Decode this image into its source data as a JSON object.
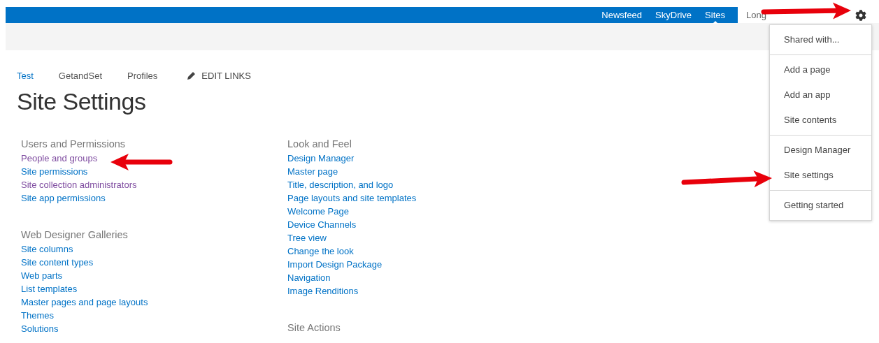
{
  "suite_bar": {
    "links": [
      {
        "label": "Newsfeed",
        "selected": false
      },
      {
        "label": "SkyDrive",
        "selected": false
      },
      {
        "label": "Sites",
        "selected": true
      }
    ],
    "user_name": "Long"
  },
  "settings_menu": {
    "groups": [
      [
        "Shared with..."
      ],
      [
        "Add a page",
        "Add an app",
        "Site contents"
      ],
      [
        "Design Manager",
        "Site settings"
      ],
      [
        "Getting started"
      ]
    ]
  },
  "nav": [
    {
      "label": "Test",
      "selected": true
    },
    {
      "label": "GetandSet",
      "selected": false
    },
    {
      "label": "Profiles",
      "selected": false
    }
  ],
  "edit_links": "EDIT LINKS",
  "title": "Site Settings",
  "columns": [
    [
      {
        "heading": "Users and Permissions",
        "links": [
          {
            "label": "People and groups",
            "visited": true
          },
          {
            "label": "Site permissions",
            "visited": false
          },
          {
            "label": "Site collection administrators",
            "visited": true
          },
          {
            "label": "Site app permissions",
            "visited": false
          }
        ]
      },
      {
        "heading": "Web Designer Galleries",
        "links": [
          {
            "label": "Site columns",
            "visited": false
          },
          {
            "label": "Site content types",
            "visited": false
          },
          {
            "label": "Web parts",
            "visited": false
          },
          {
            "label": "List templates",
            "visited": false
          },
          {
            "label": "Master pages and page layouts",
            "visited": false
          },
          {
            "label": "Themes",
            "visited": false
          },
          {
            "label": "Solutions",
            "visited": false
          }
        ]
      }
    ],
    [
      {
        "heading": "Look and Feel",
        "links": [
          {
            "label": "Design Manager",
            "visited": false
          },
          {
            "label": "Master page",
            "visited": false
          },
          {
            "label": "Title, description, and logo",
            "visited": false
          },
          {
            "label": "Page layouts and site templates",
            "visited": false
          },
          {
            "label": "Welcome Page",
            "visited": false
          },
          {
            "label": "Device Channels",
            "visited": false
          },
          {
            "label": "Tree view",
            "visited": false
          },
          {
            "label": "Change the look",
            "visited": false
          },
          {
            "label": "Import Design Package",
            "visited": false
          },
          {
            "label": "Navigation",
            "visited": false
          },
          {
            "label": "Image Renditions",
            "visited": false
          }
        ]
      },
      {
        "heading": "Site Actions"
      }
    ]
  ]
}
